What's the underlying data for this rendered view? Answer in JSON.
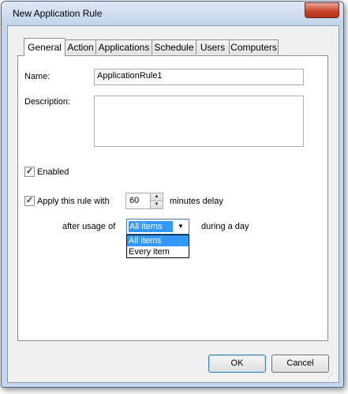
{
  "window": {
    "title": "New Application Rule",
    "close_glyph": "✕"
  },
  "tabs": [
    {
      "label": "General",
      "active": true
    },
    {
      "label": "Action"
    },
    {
      "label": "Applications"
    },
    {
      "label": "Schedule"
    },
    {
      "label": "Users"
    },
    {
      "label": "Computers"
    }
  ],
  "form": {
    "name_label": "Name:",
    "name_value": "ApplicationRule1",
    "description_label": "Description:",
    "description_value": "",
    "enabled_label": "Enabled",
    "enabled_checked": true,
    "apply_label": "Apply this rule with",
    "apply_checked": true,
    "delay_value": "60",
    "delay_suffix": "minutes delay",
    "usage_prefix": "after usage of",
    "usage_selected": "All items",
    "usage_suffix": "during a day",
    "usage_options": [
      "All items",
      "Every item"
    ]
  },
  "icons": {
    "check": "✓",
    "spin_up": "▲",
    "spin_down": "▼",
    "combo_arrow": "▼"
  },
  "buttons": {
    "ok": "OK",
    "cancel": "Cancel"
  }
}
